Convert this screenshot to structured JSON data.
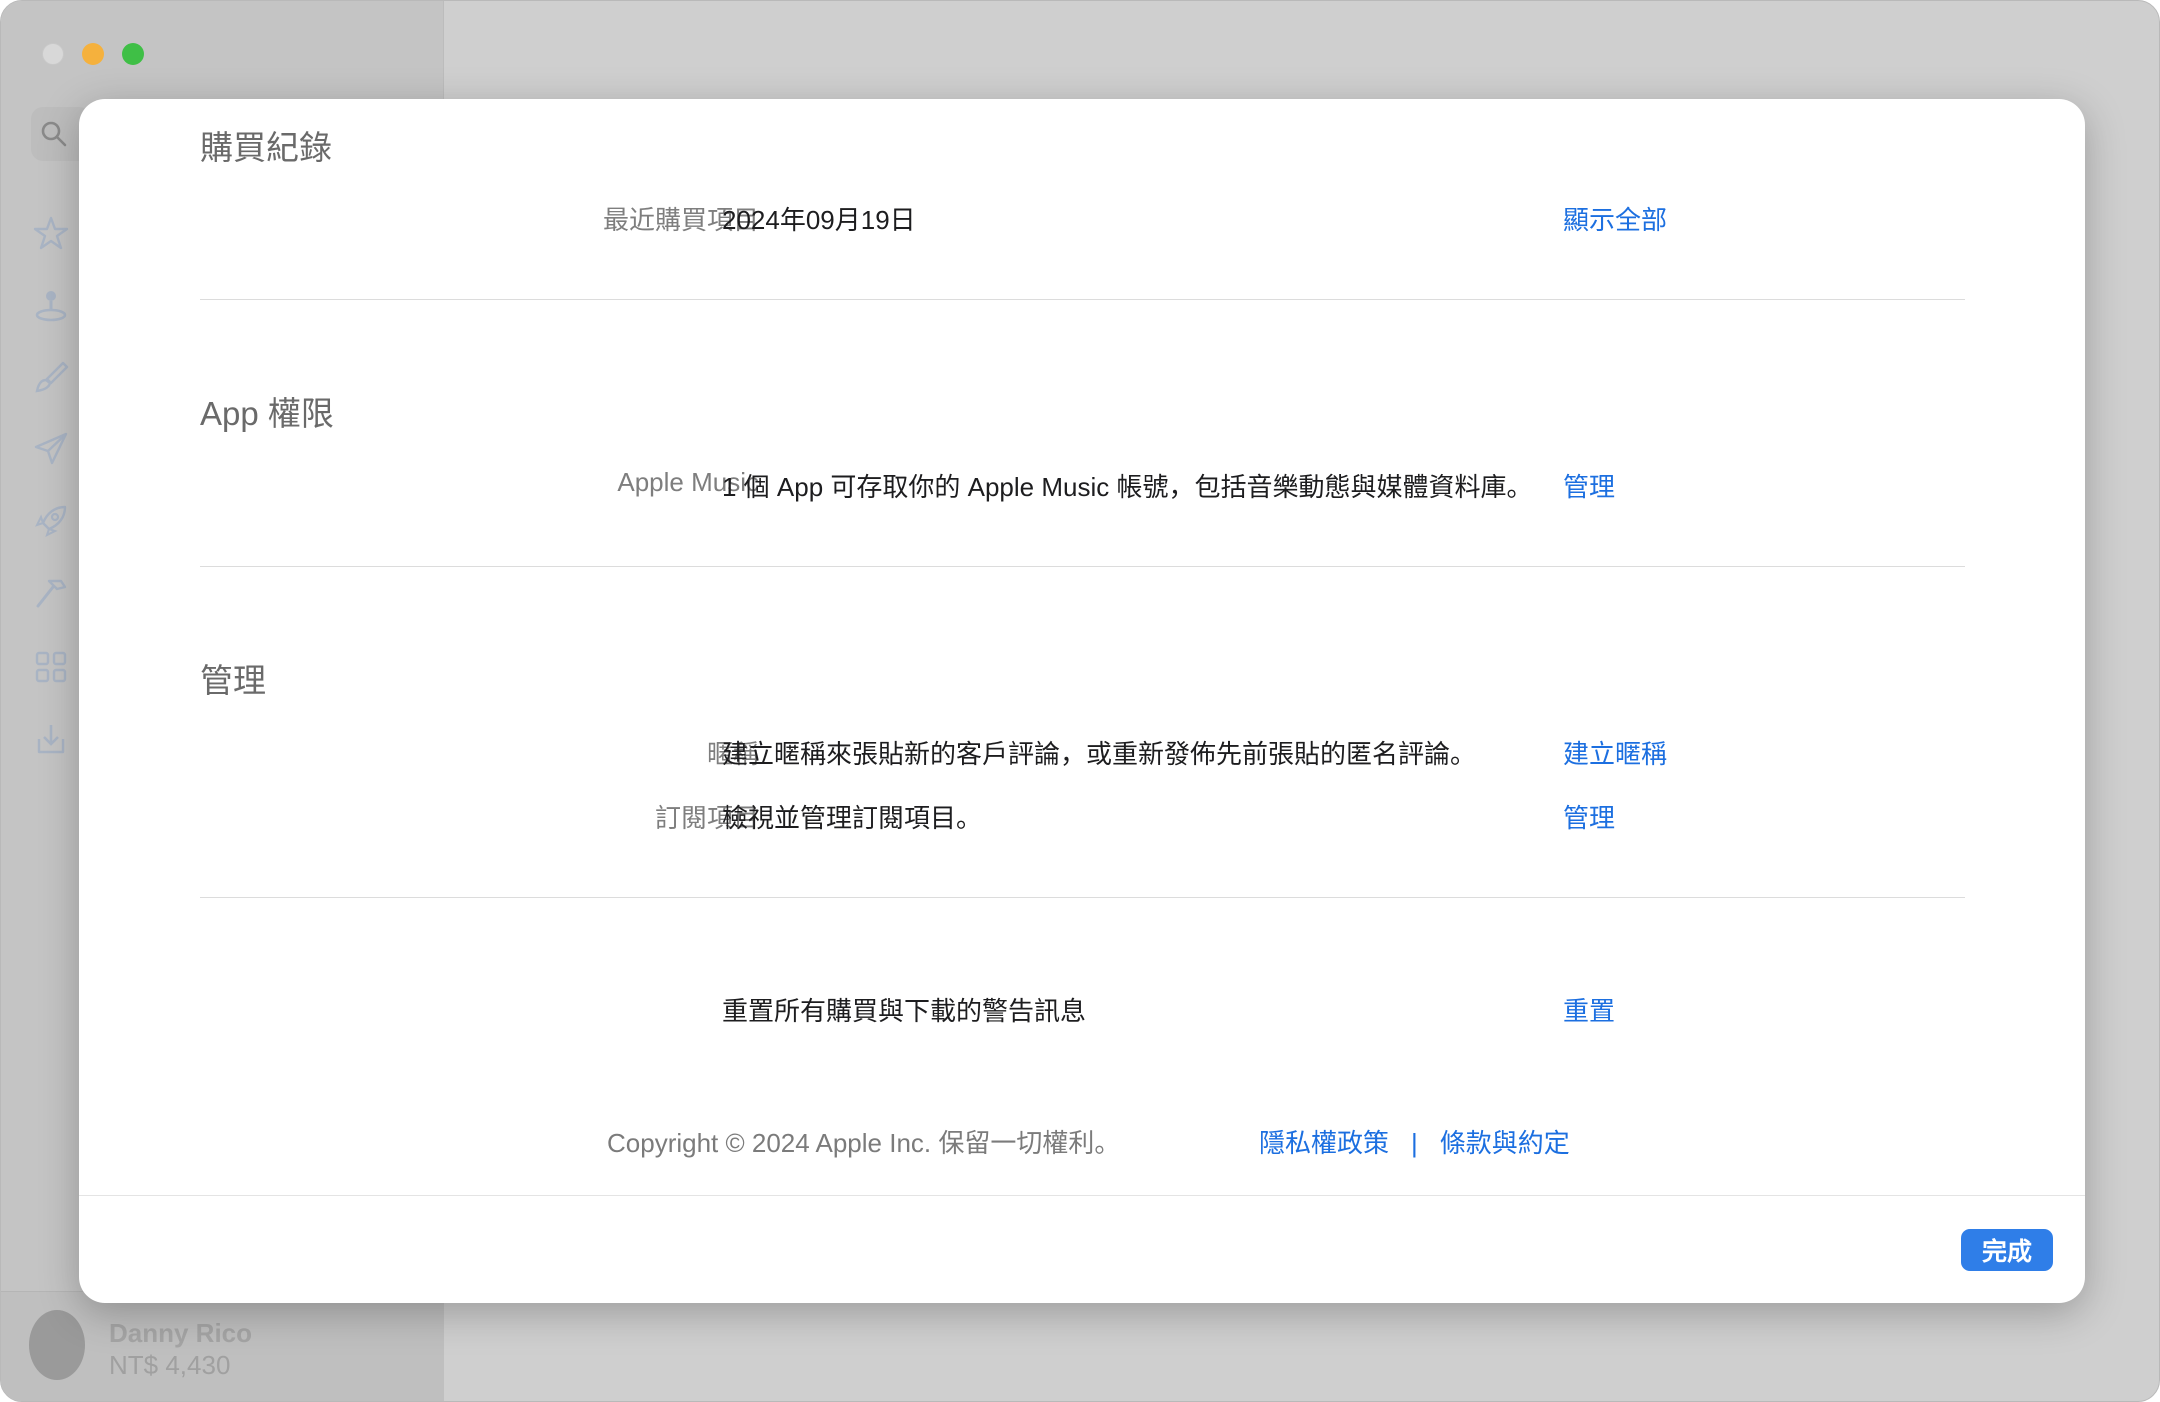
{
  "sidebar": {
    "icons": [
      "search-icon",
      "star-icon",
      "joystick-icon",
      "brush-icon",
      "send-icon",
      "rocket-icon",
      "hammer-icon",
      "grid-icon",
      "download-icon"
    ],
    "account": {
      "name": "Danny Rico",
      "balance": "NT$ 4,430"
    }
  },
  "purchase": {
    "title": "購買紀錄",
    "label": "最近購買項目",
    "value": "2024年09月19日",
    "link": "顯示全部"
  },
  "permissions": {
    "title": "App 權限",
    "label": "Apple Music",
    "value": "1 個 App 可存取你的 Apple Music 帳號，包括音樂動態與媒體資料庫。",
    "link": "管理"
  },
  "manage": {
    "title": "管理",
    "nickname": {
      "label": "暱稱",
      "value": "建立暱稱來張貼新的客戶評論，或重新發佈先前張貼的匿名評論。",
      "link": "建立暱稱"
    },
    "subscriptions": {
      "label": "訂閱項目",
      "value": "檢視並管理訂閱項目。",
      "link": "管理"
    }
  },
  "reset": {
    "value": "重置所有購買與下載的警告訊息",
    "link": "重置"
  },
  "footer": {
    "copyright": "Copyright © 2024 Apple Inc. 保留一切權利。",
    "privacy": "隱私權政策",
    "separator": "|",
    "terms": "條款與約定"
  },
  "done_label": "完成",
  "colors": {
    "accent": "#1c6fe0",
    "button": "#2f7ee8"
  }
}
